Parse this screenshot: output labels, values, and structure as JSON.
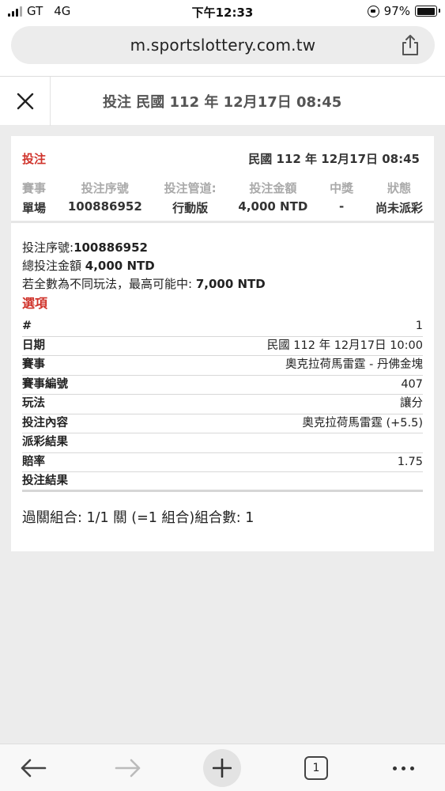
{
  "status_bar": {
    "carrier": "GT",
    "network": "4G",
    "time": "下午12:33",
    "battery": "97%",
    "battery_level": 0.97
  },
  "browser": {
    "url": "m.sportslottery.com.tw",
    "tab_count": "1"
  },
  "header": {
    "title": "投注 民國 112 年 12月17日 08:45"
  },
  "bet_card": {
    "label": "投注",
    "date": "民國 112 年 12月17日 08:45",
    "columns": [
      {
        "header": "賽事",
        "value": "單場"
      },
      {
        "header": "投注序號",
        "value": "100886952"
      },
      {
        "header": "投注管道:",
        "value": "行動版"
      },
      {
        "header": "投注金額",
        "value": "4,000 NTD"
      },
      {
        "header": "中獎",
        "value": "-"
      },
      {
        "header": "狀態",
        "value": "尚未派彩"
      }
    ]
  },
  "details": {
    "serial_label": "投注序號:",
    "serial_value": "100886952",
    "total_label": "總投注金額 ",
    "total_value": "4,000 NTD",
    "max_label": "若全數為不同玩法，最高可能中: ",
    "max_value": "7,000 NTD",
    "options_title": "選項",
    "rows": [
      {
        "key": "#",
        "value": "1"
      },
      {
        "key": "日期",
        "value": "民國 112 年 12月17日 10:00"
      },
      {
        "key": "賽事",
        "value": "奧克拉荷馬雷霆 - 丹佛金塊"
      },
      {
        "key": "賽事編號",
        "value": "407"
      },
      {
        "key": "玩法",
        "value": "讓分"
      },
      {
        "key": "投注內容",
        "value": "奧克拉荷馬雷霆 (+5.5)"
      },
      {
        "key": "派彩結果",
        "value": ""
      },
      {
        "key": "賠率",
        "value": "1.75"
      },
      {
        "key": "投注結果",
        "value": ""
      }
    ],
    "parlay": "過關組合: 1/1 關 (=1 組合)組合數: 1"
  },
  "icons": {
    "close": "close-icon",
    "share": "share-icon",
    "back": "back-arrow-icon",
    "forward": "forward-arrow-icon",
    "new_tab": "plus-icon",
    "tabs": "tabs-icon",
    "more": "more-dots-icon"
  },
  "colors": {
    "accent_red": "#d0342c",
    "muted_header": "#aaaaaa"
  }
}
